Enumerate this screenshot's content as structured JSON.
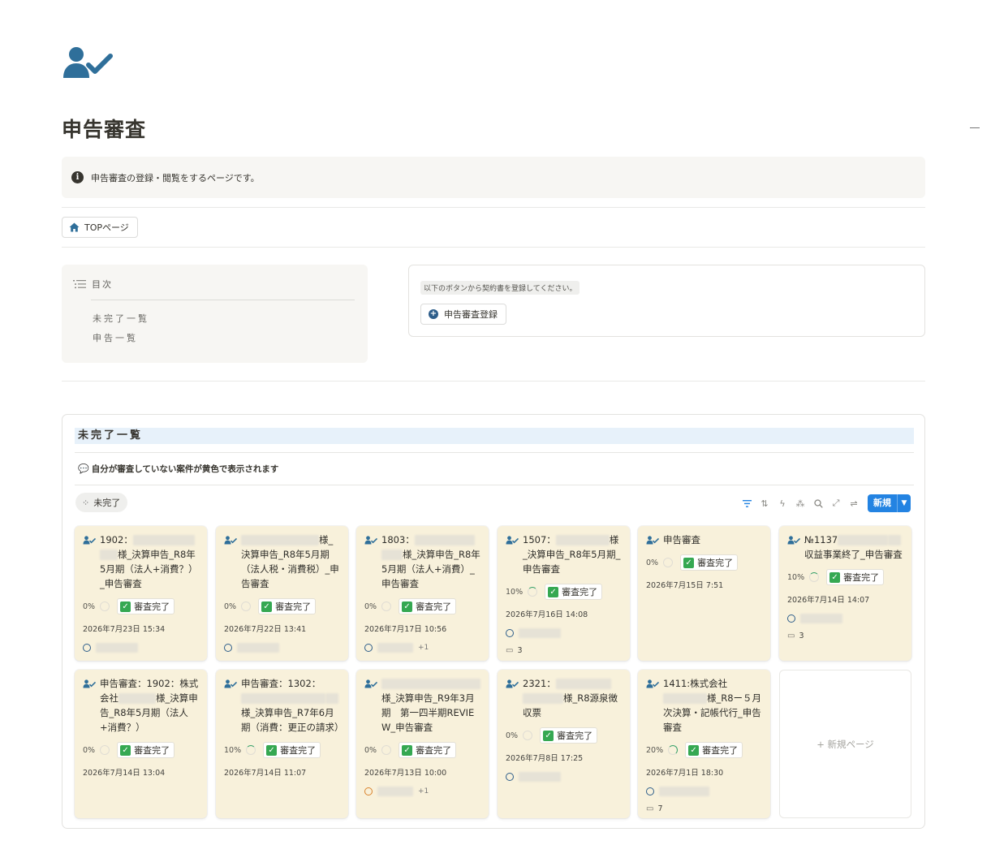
{
  "page": {
    "icon": "person-check-icon",
    "title": "申告審査",
    "callout": {
      "icon": "info-icon",
      "text": "申告審査の登録・閲覧をするページです。"
    },
    "top_link": {
      "icon": "home-icon",
      "label": "TOPページ"
    }
  },
  "toc": {
    "icon": "list-icon",
    "title": "目次",
    "items": [
      "未完了一覧",
      "申告一覧"
    ]
  },
  "register": {
    "note": "以下のボタンから契約書を登録してください。",
    "button_label": "申告審査登録",
    "button_icon": "plus-circle-icon"
  },
  "board": {
    "title": "未完了一覧",
    "subtitle": "自分が審査していない案件が黄色で表示されます",
    "subtitle_icon": "speech-bubble-icon",
    "view_tab": "未完了",
    "tools": [
      "filter-icon",
      "sort-icon",
      "lightning-icon",
      "magic-icon",
      "search-icon",
      "expand-icon",
      "settings-icon"
    ],
    "new_button": "新規",
    "new_page_label": "+ 新規ページ",
    "card_color": "#f8f1db",
    "accent": "#2383e2",
    "cards": [
      {
        "title_a": "1902：",
        "title_b": "様_決算申告_R8年5月期（法人+消費？）_申告審査",
        "percent": "0%",
        "status": "審査完了",
        "date": "2026年7月23日 15:34",
        "person": true
      },
      {
        "title_a": "",
        "title_b": "様_決算申告_R8年5月期（法人税・消費税）_申告審査",
        "percent": "0%",
        "status": "審査完了",
        "date": "2026年7月22日 13:41",
        "person": true
      },
      {
        "title_a": "1803：",
        "title_b": "様_決算申告_R8年5月期（法人+消費）_申告審査",
        "percent": "0%",
        "status": "審査完了",
        "date": "2026年7月17日 10:56",
        "person": true,
        "extra": "+1"
      },
      {
        "title_a": "1507：",
        "title_b": "様_決算申告_R8年5月期_申告審査",
        "percent": "10%",
        "status": "審査完了",
        "date": "2026年7月16日 14:08",
        "person": true,
        "comments": "3"
      },
      {
        "title_a": "申告審査",
        "title_b": "",
        "percent": "0%",
        "status": "審査完了",
        "date": "2026年7月15日 7:51"
      },
      {
        "title_a": "№1137",
        "title_b": "収益事業終了_申告審査",
        "percent": "10%",
        "status": "審査完了",
        "date": "2026年7月14日 14:07",
        "person": true,
        "comments": "3"
      },
      {
        "title_a": "申告審査：1902：株式会社",
        "title_b": "様_決算申告_R8年5月期（法人+消費？）",
        "percent": "0%",
        "status": "審査完了",
        "date": "2026年7月14日 13:04"
      },
      {
        "title_a": "申告審査：1302：",
        "title_b": "様_決算申告_R7年6月期（消費：更正の請求）",
        "percent": "10%",
        "status": "審査完了",
        "date": "2026年7月14日 11:07"
      },
      {
        "title_a": "",
        "title_b": "様_決算申告_R9年3月期　第一四半期REVIEW_申告審査",
        "percent": "0%",
        "status": "審査完了",
        "date": "2026年7月13日 10:00",
        "person": true,
        "person_color": "orange",
        "extra": "+1"
      },
      {
        "title_a": "2321：",
        "title_b": "様_R8源泉徴収票",
        "percent": "0%",
        "status": "審査完了",
        "date": "2026年7月8日 17:25",
        "person": true
      },
      {
        "title_a": "1411:株式会社",
        "title_b": "様_R8ー５月次決算・記帳代行_申告審査",
        "percent": "20%",
        "status": "審査完了",
        "date": "2026年7月1日 18:30",
        "person": true,
        "comments": "7"
      }
    ]
  }
}
